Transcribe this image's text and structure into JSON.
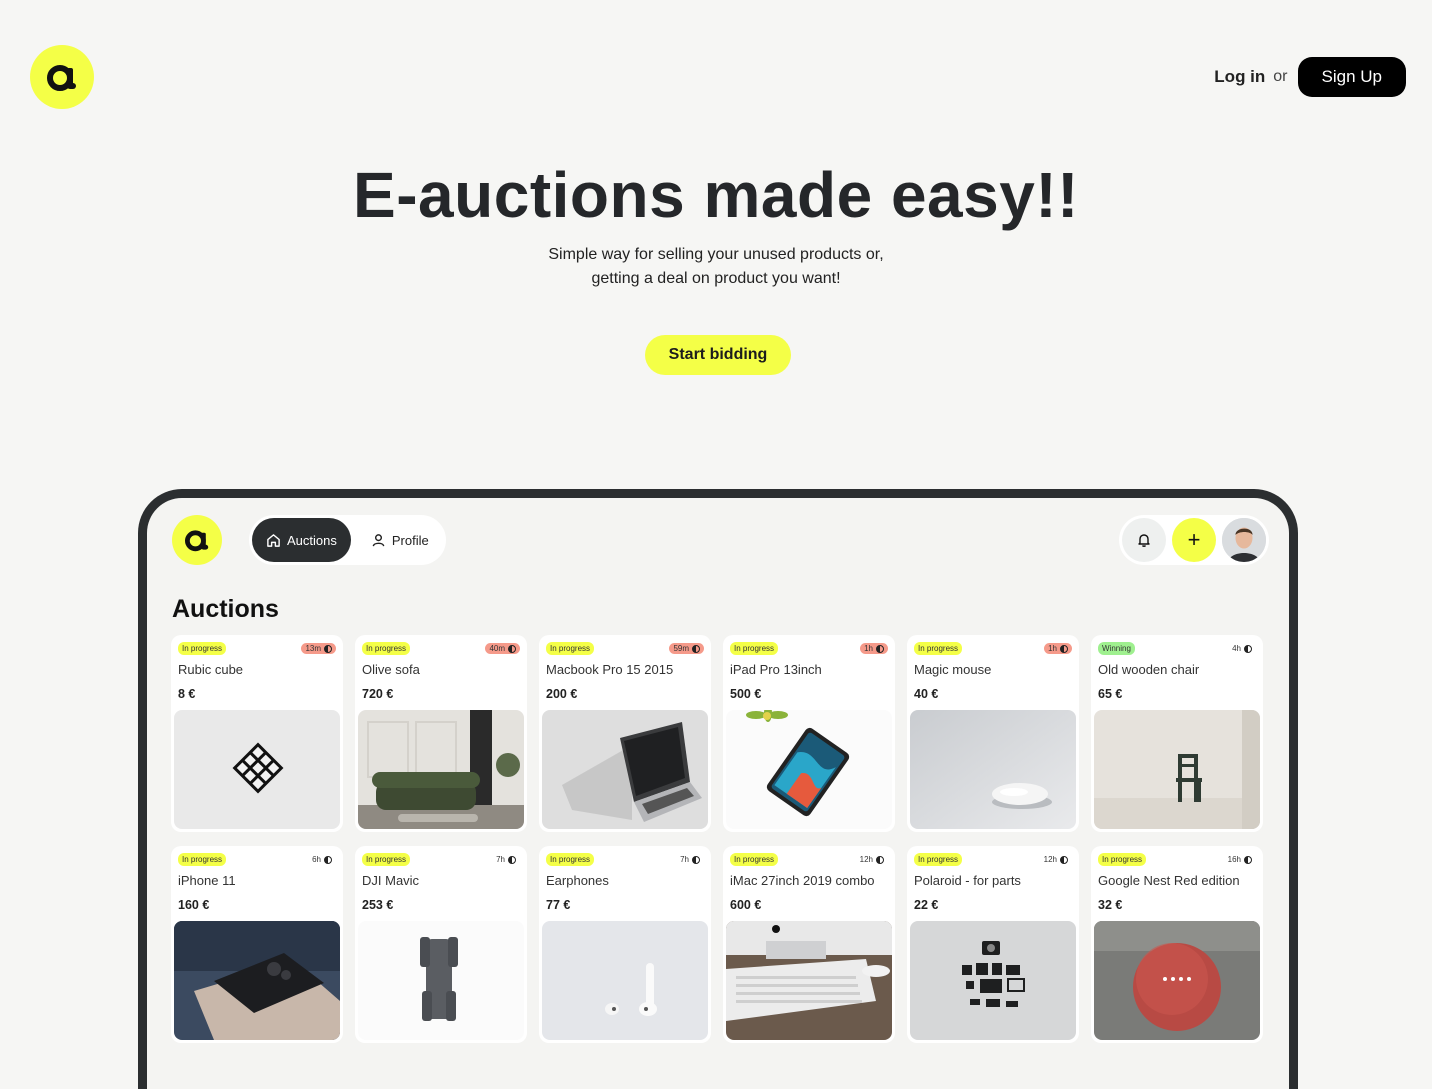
{
  "header": {
    "logo_letter": "a",
    "login_label": "Log in",
    "or_label": "or",
    "signup_label": "Sign Up"
  },
  "hero": {
    "title": "E-auctions made easy!!",
    "subtitle_line1": "Simple way for selling your unused products or,",
    "subtitle_line2": "getting a deal on product you want!",
    "cta_label": "Start bidding"
  },
  "app": {
    "logo_letter": "a",
    "tabs": [
      {
        "label": "Auctions",
        "icon": "home-icon",
        "active": true
      },
      {
        "label": "Profile",
        "icon": "user-icon",
        "active": false
      }
    ],
    "actions": {
      "bell_icon": "bell-icon",
      "plus_label": "+",
      "avatar": "avatar"
    },
    "section_title": "Auctions",
    "cards": [
      {
        "status": "In progress",
        "status_type": "progress",
        "time": "13m",
        "urgent": true,
        "name": "Rubic cube",
        "price": "8 €",
        "image": "rubic-cube"
      },
      {
        "status": "In progress",
        "status_type": "progress",
        "time": "40m",
        "urgent": true,
        "name": "Olive sofa",
        "price": "720 €",
        "image": "sofa"
      },
      {
        "status": "In progress",
        "status_type": "progress",
        "time": "59m",
        "urgent": true,
        "name": "Macbook Pro 15 2015",
        "price": "200 €",
        "image": "laptop"
      },
      {
        "status": "In progress",
        "status_type": "progress",
        "time": "1h",
        "urgent": true,
        "name": "iPad Pro 13inch",
        "price": "500 €",
        "image": "ipad"
      },
      {
        "status": "In progress",
        "status_type": "progress",
        "time": "1h",
        "urgent": true,
        "name": "Magic mouse",
        "price": "40 €",
        "image": "mouse"
      },
      {
        "status": "Winning",
        "status_type": "winning",
        "time": "4h",
        "urgent": false,
        "name": "Old wooden chair",
        "price": "65 €",
        "image": "chair"
      },
      {
        "status": "In progress",
        "status_type": "progress",
        "time": "6h",
        "urgent": false,
        "name": "iPhone 11",
        "price": "160 €",
        "image": "iphone"
      },
      {
        "status": "In progress",
        "status_type": "progress",
        "time": "7h",
        "urgent": false,
        "name": "DJI Mavic",
        "price": "253 €",
        "image": "drone"
      },
      {
        "status": "In progress",
        "status_type": "progress",
        "time": "7h",
        "urgent": false,
        "name": "Earphones",
        "price": "77 €",
        "image": "earphones"
      },
      {
        "status": "In progress",
        "status_type": "progress",
        "time": "12h",
        "urgent": false,
        "name": "iMac 27inch 2019 combo",
        "price": "600 €",
        "image": "imac"
      },
      {
        "status": "In progress",
        "status_type": "progress",
        "time": "12h",
        "urgent": false,
        "name": "Polaroid - for parts",
        "price": "22 €",
        "image": "polaroid"
      },
      {
        "status": "In progress",
        "status_type": "progress",
        "time": "16h",
        "urgent": false,
        "name": "Google Nest Red edition",
        "price": "32 €",
        "image": "nest"
      }
    ]
  },
  "colors": {
    "accent": "#f4ff47",
    "dark": "#2b2e30",
    "urgent": "#f59a8a",
    "winning": "#9ff08f",
    "background": "#f6f6f4"
  }
}
